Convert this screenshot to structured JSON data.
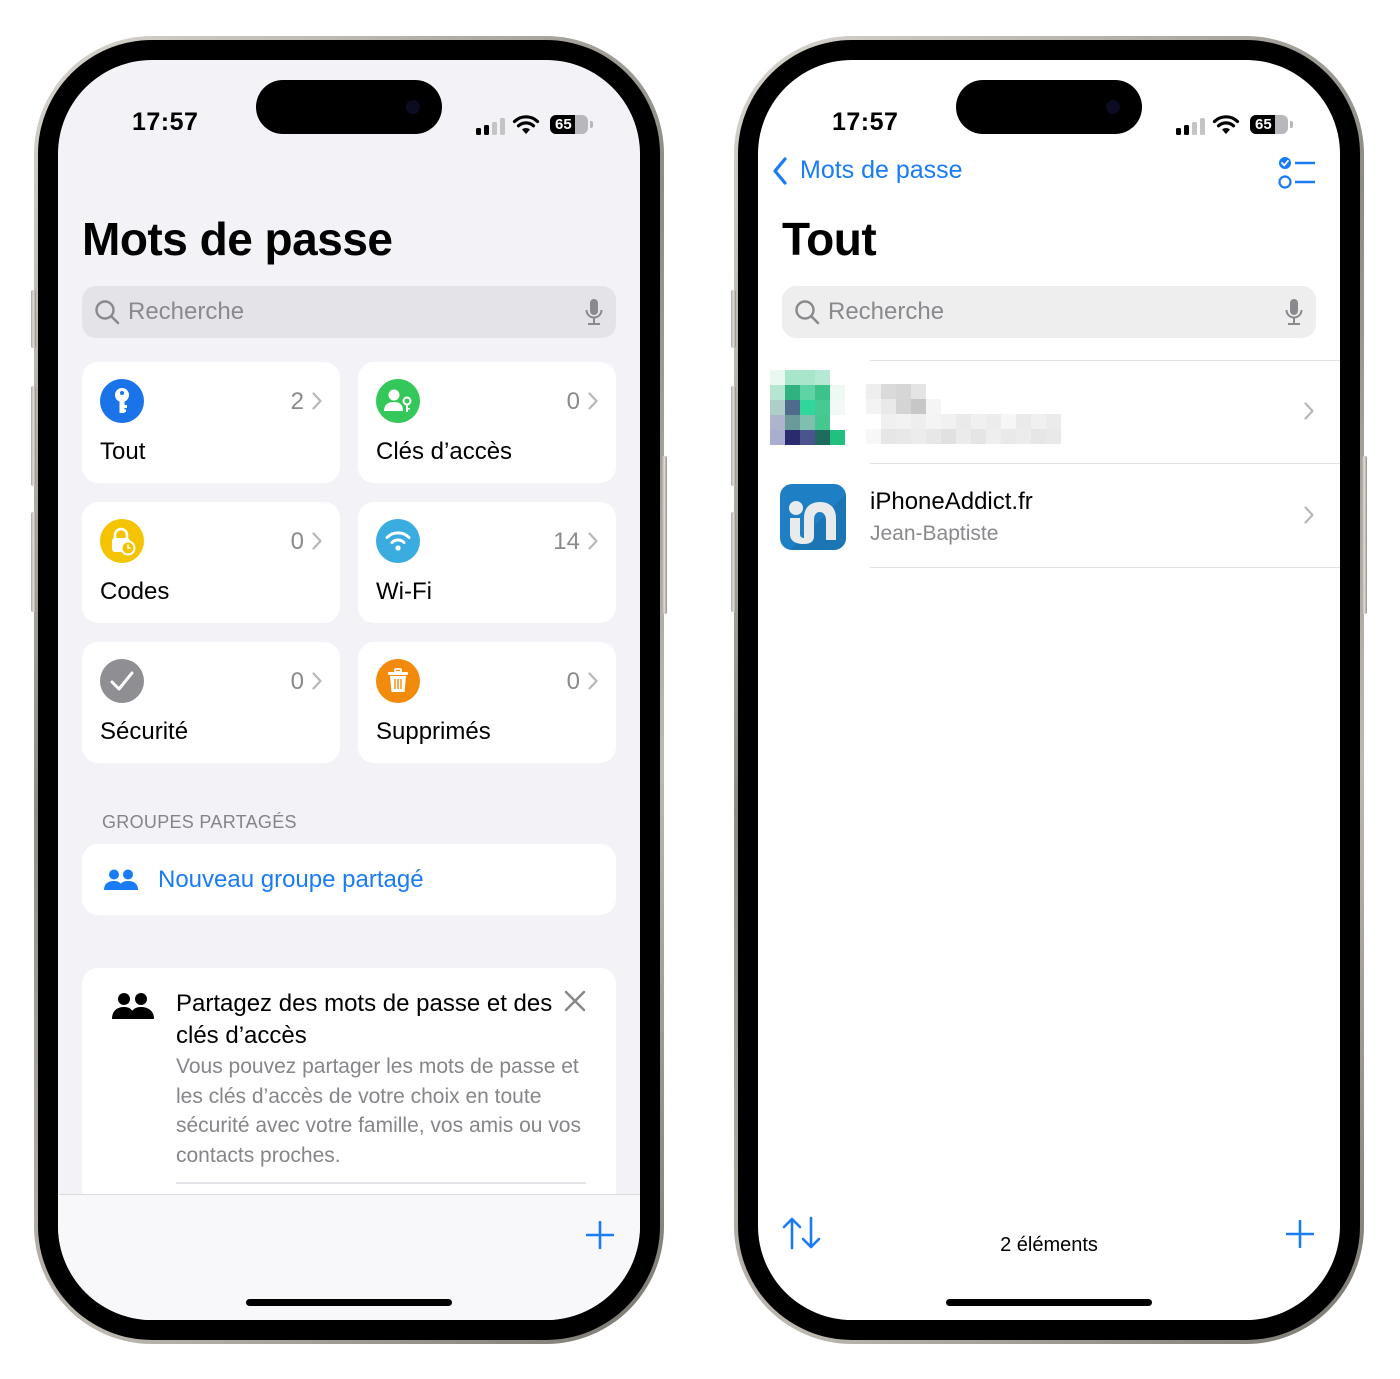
{
  "status_bar": {
    "time": "17:57",
    "battery_percent": 65,
    "battery_label": "65",
    "signal_bars_active": 2,
    "signal_bars_total": 4
  },
  "colors": {
    "accent": "#1a7cf5",
    "tout_icon": "#1a73e8",
    "cles_icon": "#34c759",
    "codes_icon": "#f5c400",
    "wifi_icon": "#3aace0",
    "securite_icon": "#8e8e93",
    "supprimes_icon": "#f28a0c"
  },
  "left_screen": {
    "title": "Mots de passe",
    "search_placeholder": "Recherche",
    "categories": [
      {
        "label": "Tout",
        "count": "2",
        "icon": "key-icon"
      },
      {
        "label": "Clés d’accès",
        "count": "0",
        "icon": "person-key-icon"
      },
      {
        "label": "Codes",
        "count": "0",
        "icon": "lock-clock-icon"
      },
      {
        "label": "Wi-Fi",
        "count": "14",
        "icon": "wifi-icon"
      },
      {
        "label": "Sécurité",
        "count": "0",
        "icon": "checkmark-icon"
      },
      {
        "label": "Supprimés",
        "count": "0",
        "icon": "trash-icon"
      }
    ],
    "shared_groups_header": "GROUPES PARTAGÉS",
    "new_group_label": "Nouveau groupe partagé",
    "promo": {
      "title": "Partagez des mots de passe et des clés d’accès",
      "body": "Vous pouvez partager les mots de passe et les clés d’accès de votre choix en toute sécurité avec votre famille, vos amis ou vos contacts proches."
    }
  },
  "right_screen": {
    "back_label": "Mots de passe",
    "title": "Tout",
    "search_placeholder": "Recherche",
    "items": [
      {
        "title": "",
        "subtitle": "",
        "redacted": true
      },
      {
        "title": "iPhoneAddict.fr",
        "subtitle": "Jean-Baptiste",
        "redacted": false
      }
    ],
    "footer_count": "2 éléments"
  }
}
